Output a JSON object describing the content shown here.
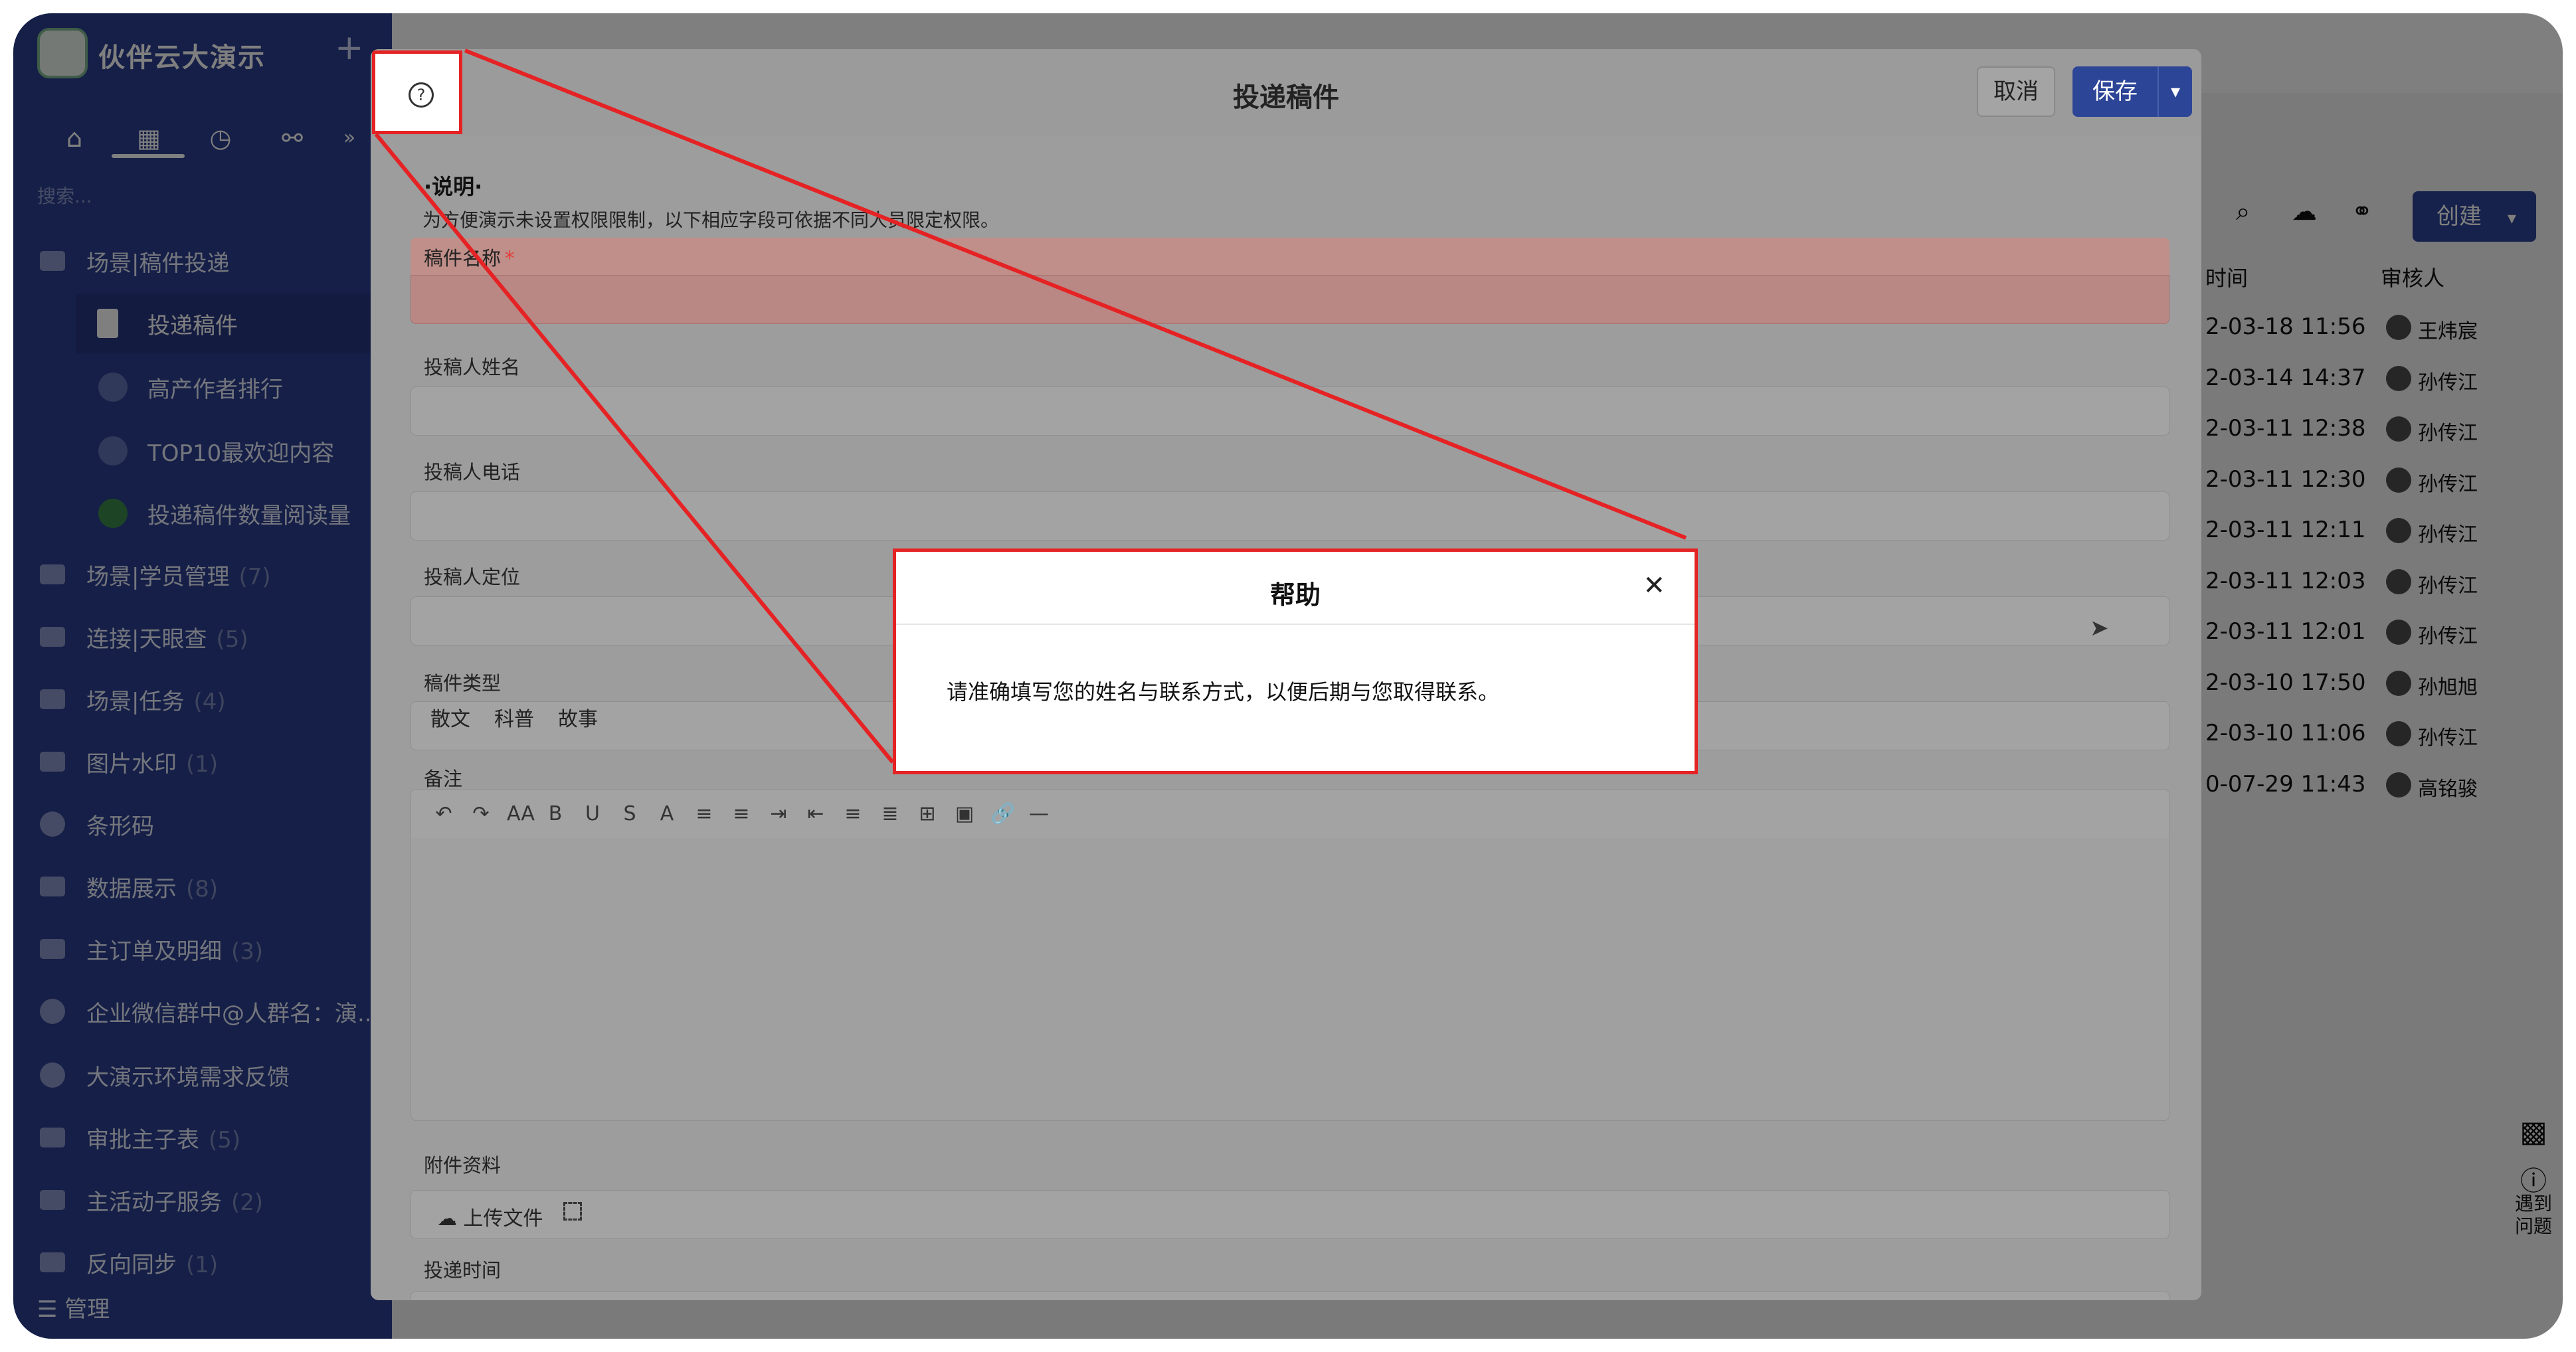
{
  "sidebar": {
    "app_title": "伙伴云大演示",
    "plus_icon": "+",
    "search_placeholder": "搜索...",
    "items": [
      {
        "label": "场景|稿件投递",
        "count": ""
      },
      {
        "label": "投递稿件",
        "count": ""
      },
      {
        "label": "高产作者排行",
        "count": ""
      },
      {
        "label": "TOP10最欢迎内容",
        "count": ""
      },
      {
        "label": "投递稿件数量阅读量",
        "count": ""
      },
      {
        "label": "场景|学员管理",
        "count": "(7)"
      },
      {
        "label": "连接|天眼查",
        "count": "(5)"
      },
      {
        "label": "场景|任务",
        "count": "(4)"
      },
      {
        "label": "图片水印",
        "count": "(1)"
      },
      {
        "label": "条形码",
        "count": ""
      },
      {
        "label": "数据展示",
        "count": "(8)"
      },
      {
        "label": "主订单及明细",
        "count": "(3)"
      },
      {
        "label": "企业微信群中@人群名：演...",
        "count": ""
      },
      {
        "label": "大演示环境需求反馈",
        "count": ""
      },
      {
        "label": "审批主子表",
        "count": "(5)"
      },
      {
        "label": "主活动子服务",
        "count": "(2)"
      },
      {
        "label": "反向同步",
        "count": "(1)"
      }
    ],
    "manage_label": "管理"
  },
  "background_table": {
    "header_time": "时间",
    "header_reviewer": "审核人",
    "create_label": "创建",
    "rows": [
      {
        "time": "2-03-18 11:56",
        "reviewer": "王炜宸"
      },
      {
        "time": "2-03-14 14:37",
        "reviewer": "孙传江"
      },
      {
        "time": "2-03-11 12:38",
        "reviewer": "孙传江"
      },
      {
        "time": "2-03-11 12:30",
        "reviewer": "孙传江"
      },
      {
        "time": "2-03-11 12:11",
        "reviewer": "孙传江"
      },
      {
        "time": "2-03-11 12:03",
        "reviewer": "孙传江"
      },
      {
        "time": "2-03-11 12:01",
        "reviewer": "孙传江"
      },
      {
        "time": "2-03-10 17:50",
        "reviewer": "孙旭旭"
      },
      {
        "time": "2-03-10 11:06",
        "reviewer": "孙传江"
      },
      {
        "time": "0-07-29 11:43",
        "reviewer": "高铭骏"
      }
    ],
    "side_help": "遇到问题"
  },
  "modal": {
    "title": "投递稿件",
    "cancel_label": "取消",
    "save_label": "保存",
    "note_title": "·说明·",
    "note_text": "为方便演示未设置权限限制，以下相应字段可依据不同人员限定权限。",
    "fields": [
      {
        "label": "稿件名称",
        "required": "*"
      },
      {
        "label": "投稿人姓名"
      },
      {
        "label": "投稿人电话"
      },
      {
        "label": "投稿人定位"
      },
      {
        "label": "稿件类型"
      },
      {
        "label": "备注"
      },
      {
        "label": "附件资料"
      },
      {
        "label": "投递时间"
      }
    ],
    "type_options": [
      "散文",
      "科普",
      "故事"
    ],
    "upload_label": "上传文件",
    "toolbar_icons": [
      "undo-icon",
      "redo-icon",
      "font-size-icon",
      "bold-icon",
      "underline-icon",
      "strikethrough-icon",
      "font-color-icon",
      "ordered-list-icon",
      "bullet-list-icon",
      "indent-icon",
      "outdent-icon",
      "align-icon",
      "line-height-icon",
      "table-icon",
      "image-icon",
      "link-icon",
      "hr-icon"
    ],
    "toolbar_glyphs": [
      "↶",
      "↷",
      "AA",
      "B",
      "U",
      "S",
      "A",
      "≡",
      "≡",
      "⇥",
      "⇤",
      "≡",
      "≣",
      "⊞",
      "▣",
      "🔗",
      "—"
    ]
  },
  "help_dialog": {
    "title": "帮助",
    "body": "请准确填写您的姓名与联系方式，以便后期与您取得联系。",
    "close_glyph": "✕"
  },
  "colors": {
    "sidebar_bg": "#2b3f8f",
    "primary": "#2d4597",
    "highlight": "#e52224"
  }
}
